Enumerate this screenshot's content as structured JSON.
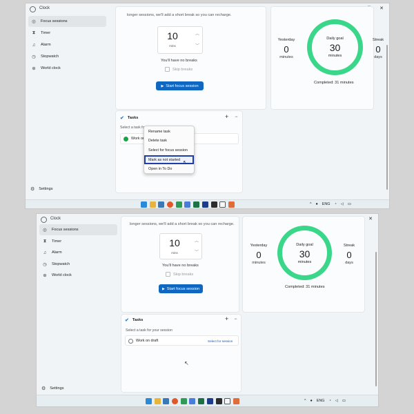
{
  "window": {
    "title": "Clock",
    "minimize": "—",
    "maximize": "□",
    "close": "✕"
  },
  "nav": {
    "items": [
      {
        "label": "Focus sessions",
        "icon": "focus-icon"
      },
      {
        "label": "Timer",
        "icon": "hourglass-icon"
      },
      {
        "label": "Alarm",
        "icon": "bell-icon"
      },
      {
        "label": "Stopwatch",
        "icon": "stopwatch-icon"
      },
      {
        "label": "World clock",
        "icon": "globe-icon"
      }
    ],
    "settings": "Settings"
  },
  "focus": {
    "hint": "longer sessions, we'll add a short break so you can recharge.",
    "duration_value": "10",
    "duration_unit": "mins",
    "no_breaks": "You'll have no breaks",
    "skip_breaks": "Skip breaks",
    "start_button": "Start focus session"
  },
  "progress": {
    "yesterday_label": "Yesterday",
    "yesterday_value": "0",
    "yesterday_unit": "minutes",
    "goal_label": "Daily goal",
    "goal_value": "30",
    "goal_unit": "minutes",
    "goal_fraction": 1,
    "streak_label": "Streak",
    "streak_value": "0",
    "streak_unit": "days",
    "completed": "Completed: 31 minutes",
    "ring_color": "#3ad68a"
  },
  "tasks": {
    "title": "Tasks",
    "add": "+",
    "more": "···",
    "subtitle_top": "Select a task fo",
    "subtitle": "Select a task for your session",
    "task_name": "Work on draft",
    "task_name_truncated": "Work on",
    "select_label": "Select for session",
    "completed_color": "#1aa34a"
  },
  "context_menu": {
    "items": [
      "Rename task",
      "Delete task",
      "Select for focus session",
      "Mark as not started",
      "Open in To Do"
    ],
    "focused_index": 3
  },
  "tray": {
    "lang": "ENG",
    "chevron": "^"
  },
  "colors": {
    "accent": "#0f67c2",
    "focus_outline": "#1f3ca8"
  }
}
